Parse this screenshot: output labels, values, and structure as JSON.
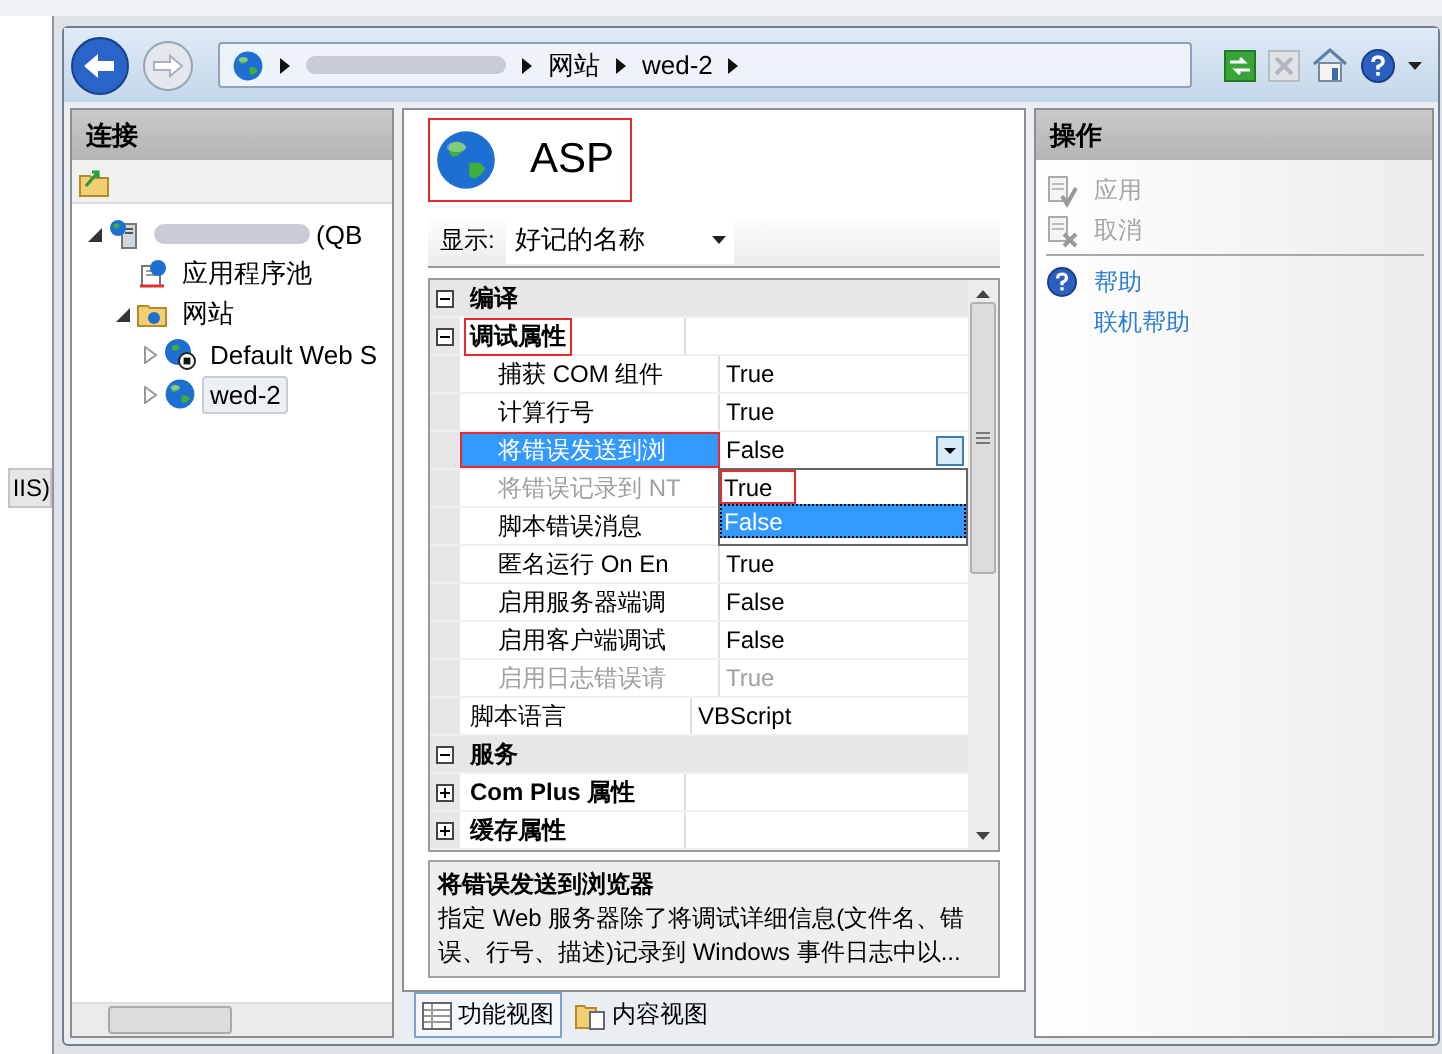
{
  "left_window": {
    "tab_text": "IIS)"
  },
  "address_bar": {
    "segments": [
      {
        "kind": "redacted"
      },
      {
        "kind": "text",
        "label": "网站"
      },
      {
        "kind": "text",
        "label": "wed-2"
      }
    ]
  },
  "connections": {
    "title": "连接",
    "tree": [
      {
        "kind": "server",
        "label": "(QB",
        "redacted": true,
        "expanded": true,
        "selected": false,
        "children": [
          {
            "kind": "pool",
            "label": "应用程序池",
            "selected": false
          },
          {
            "kind": "sites",
            "label": "网站",
            "expanded": true,
            "selected": false,
            "children": [
              {
                "kind": "stopped",
                "label": "Default Web S",
                "expanded": false,
                "selected": false
              },
              {
                "kind": "site",
                "label": "wed-2",
                "expanded": false,
                "selected": true
              }
            ]
          }
        ]
      }
    ]
  },
  "feature": {
    "title": "ASP",
    "highlighted": true
  },
  "display": {
    "label": "显示:",
    "value": "好记的名称"
  },
  "grid": [
    {
      "kind": "category",
      "label": "编译",
      "expanded": true,
      "children": [
        {
          "kind": "group",
          "label": "调试属性",
          "expanded": true,
          "highlighted": true,
          "children": [
            {
              "kind": "property",
              "name": "捕获 COM 组件",
              "value": "True",
              "disabled": false,
              "selected": false
            },
            {
              "kind": "property",
              "name": "计算行号",
              "value": "True",
              "disabled": false,
              "selected": false
            },
            {
              "kind": "property",
              "name": "将错误发送到浏",
              "value": "False",
              "disabled": false,
              "selected": true,
              "highlighted": true,
              "dropdown": [
                {
                  "label": "True",
                  "selected": false,
                  "highlighted": true
                },
                {
                  "label": "False",
                  "selected": true,
                  "highlighted": false
                }
              ]
            },
            {
              "kind": "property",
              "name": "将错误记录到 NT",
              "disabled": true,
              "selected": false
            },
            {
              "kind": "property",
              "name": "脚本错误消息",
              "disabled": false,
              "selected": false
            },
            {
              "kind": "property",
              "name": "匿名运行 On En",
              "value": "True",
              "disabled": false,
              "selected": false
            },
            {
              "kind": "property",
              "name": "启用服务器端调",
              "value": "False",
              "disabled": false,
              "selected": false
            },
            {
              "kind": "property",
              "name": "启用客户端调试",
              "value": "False",
              "disabled": false,
              "selected": false
            },
            {
              "kind": "property",
              "name": "启用日志错误请",
              "value": "True",
              "disabled": true,
              "selected": false
            }
          ]
        },
        {
          "kind": "property",
          "name": "脚本语言",
          "value": "VBScript",
          "disabled": false,
          "selected": false
        }
      ]
    },
    {
      "kind": "category",
      "label": "服务",
      "expanded": true,
      "children": [
        {
          "kind": "group",
          "label": "Com Plus 属性",
          "expanded": false,
          "highlighted": false
        },
        {
          "kind": "group",
          "label": "缓存属性",
          "expanded": false,
          "highlighted": false
        }
      ]
    }
  ],
  "description": {
    "title": "将错误发送到浏览器",
    "text": "指定 Web 服务器除了将调试详细信息(文件名、错误、行号、描述)记录到 Windows 事件日志中以..."
  },
  "views": [
    {
      "kind": "features",
      "label": "功能视图",
      "selected": true
    },
    {
      "kind": "content",
      "label": "内容视图",
      "selected": false
    }
  ],
  "actions": {
    "title": "操作",
    "items": [
      {
        "kind": "apply",
        "label": "应用",
        "disabled": true
      },
      {
        "kind": "cancel",
        "label": "取消",
        "disabled": true
      },
      {
        "kind": "help",
        "label": "帮助"
      },
      {
        "kind": "link",
        "label": "联机帮助"
      }
    ]
  }
}
